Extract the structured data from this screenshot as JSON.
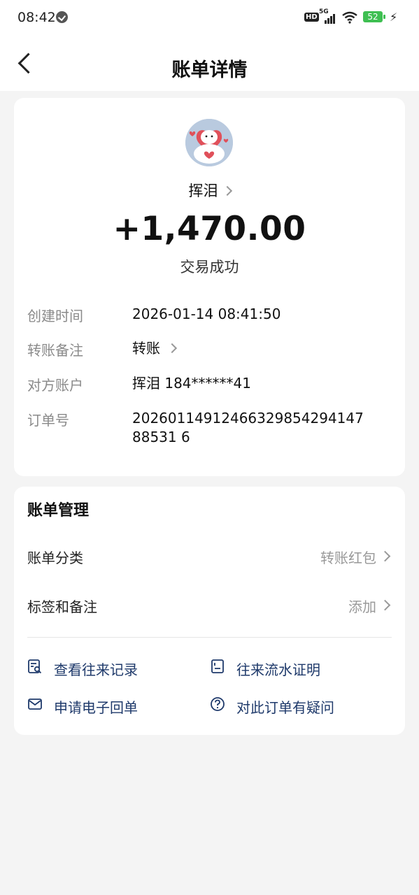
{
  "status_bar": {
    "time": "08:42",
    "network_hd": "HD",
    "network_type": "5G",
    "battery": "52"
  },
  "header": {
    "title": "账单详情"
  },
  "transaction": {
    "counterparty_name": "挥泪",
    "amount": "+1,470.00",
    "status": "交易成功"
  },
  "details": [
    {
      "label": "创建时间",
      "value": "2026-01-14 08:41:50"
    },
    {
      "label": "转账备注",
      "value": "转账"
    },
    {
      "label": "对方账户",
      "value": "挥泪 184******41"
    },
    {
      "label": "订单号",
      "value": "2026011491246632985429414788531 6"
    }
  ],
  "management": {
    "title": "账单管理",
    "category_label": "账单分类",
    "category_value": "转账红包",
    "tags_label": "标签和备注",
    "tags_value": "添加",
    "actions": [
      {
        "label": "查看往来记录",
        "icon": "record-search-icon"
      },
      {
        "label": "往来流水证明",
        "icon": "document-icon"
      },
      {
        "label": "申请电子回单",
        "icon": "mail-icon"
      },
      {
        "label": "对此订单有疑问",
        "icon": "question-circle-icon"
      }
    ]
  },
  "colors": {
    "accent": "#1f3a6b",
    "background": "#f4f4f4",
    "battery": "#3fbf52"
  }
}
